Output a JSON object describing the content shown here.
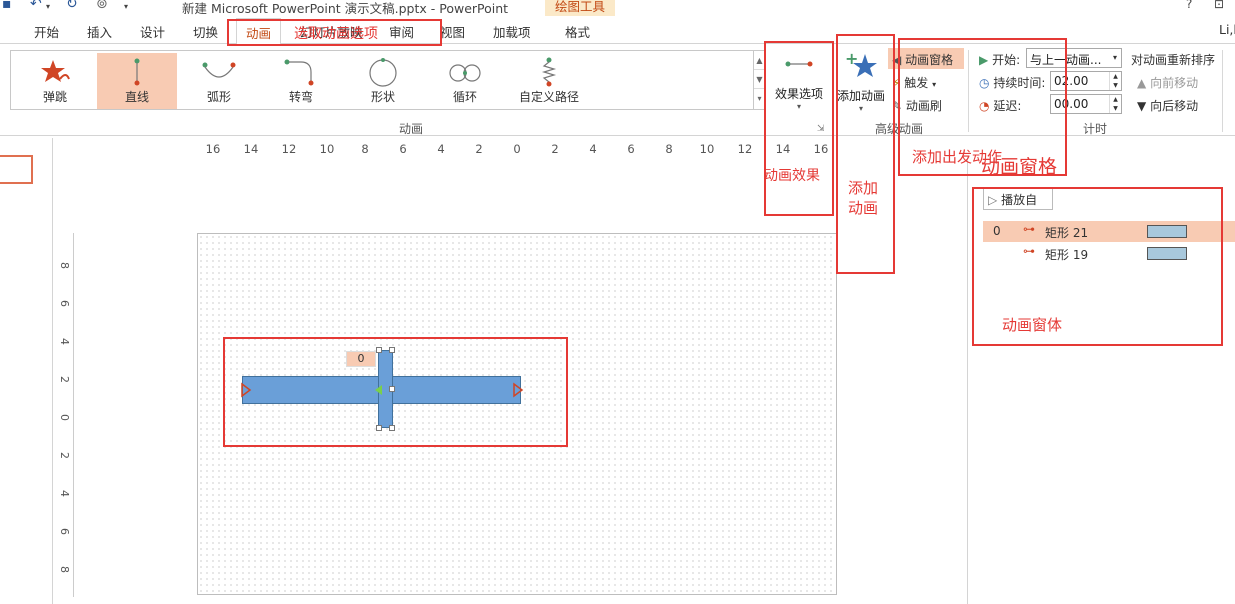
{
  "window": {
    "title": "新建 Microsoft PowerPoint 演示文稿.pptx - PowerPoint",
    "context_tab_group": "绘图工具",
    "help": "?",
    "user": "Li,l"
  },
  "tabs": [
    "开始",
    "插入",
    "设计",
    "切换",
    "动画",
    "幻灯片放映",
    "审阅",
    "视图",
    "加载项",
    "格式"
  ],
  "active_tab": "动画",
  "animation_gallery": {
    "items": [
      {
        "label": "弹跳",
        "icon": "bounce-icon"
      },
      {
        "label": "直线",
        "icon": "line-path-icon",
        "selected": true
      },
      {
        "label": "弧形",
        "icon": "arc-path-icon"
      },
      {
        "label": "转弯",
        "icon": "turn-path-icon"
      },
      {
        "label": "形状",
        "icon": "shape-path-icon"
      },
      {
        "label": "循环",
        "icon": "loop-path-icon"
      },
      {
        "label": "自定义路径",
        "icon": "custom-path-icon"
      }
    ],
    "group_label": "动画"
  },
  "effect_options": {
    "label": "效果选项"
  },
  "advanced_animation": {
    "group_label": "高级动画",
    "add_animation": "添加动画",
    "animation_pane": "动画窗格",
    "trigger": "触发",
    "animation_painter": "动画刷"
  },
  "timing": {
    "group_label": "计时",
    "start_label": "开始:",
    "start_value": "与上一动画...",
    "duration_label": "持续时间:",
    "duration_value": "02.00",
    "delay_label": "延迟:",
    "delay_value": "00.00",
    "reorder_title": "对动画重新排序",
    "move_earlier": "向前移动",
    "move_later": "向后移动"
  },
  "ruler": {
    "h_ticks": [
      "16",
      "14",
      "12",
      "10",
      "8",
      "6",
      "4",
      "2",
      "0",
      "2",
      "4",
      "6",
      "8",
      "10",
      "12",
      "14",
      "16"
    ],
    "v_ticks": [
      "8",
      "6",
      "4",
      "2",
      "0",
      "2",
      "4",
      "6",
      "8"
    ]
  },
  "slide": {
    "animation_tag": "0"
  },
  "animation_pane": {
    "play_from": "播放自",
    "items": [
      {
        "index": "0",
        "name": "矩形 21",
        "selected": true
      },
      {
        "index": "",
        "name": "矩形 19",
        "selected": false
      }
    ]
  },
  "annotations": {
    "animation_options": "选取动画选项",
    "animation_effect": "动画效果",
    "add_animation": "添加\n动画",
    "add_trigger_action": "添加出发动作",
    "animation_pane_title": "动画窗格",
    "animation_pane_body": "动画窗体"
  },
  "colors": {
    "accent": "#c24a14",
    "selection": "#f8cbb3",
    "annotation_red": "#e53935",
    "shape_fill": "#6a9fd8"
  }
}
